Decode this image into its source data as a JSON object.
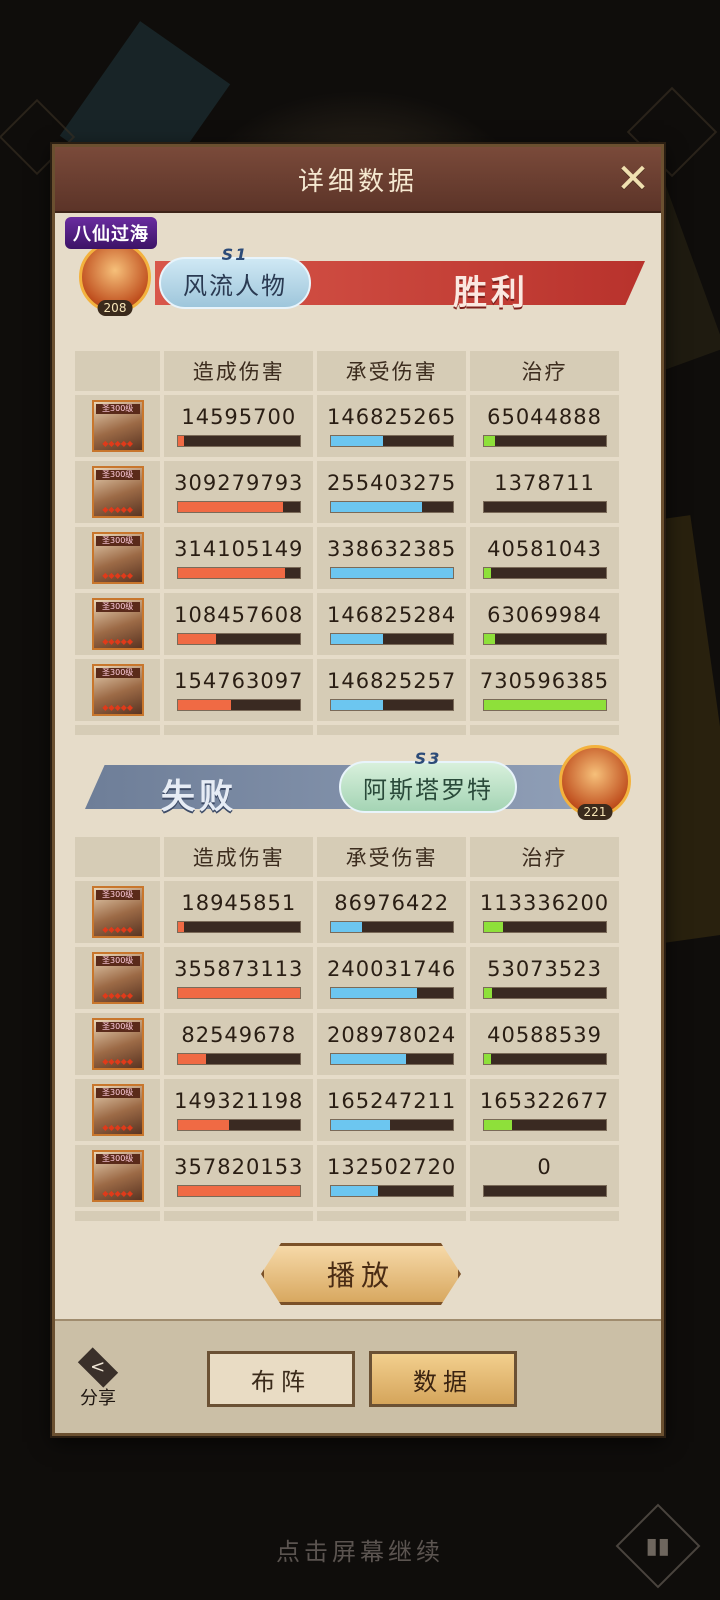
{
  "panel": {
    "title": "详细数据",
    "close_icon": "close-icon"
  },
  "team_top": {
    "badge": "八仙过海",
    "season": "S1",
    "name": "风流人物",
    "level": "208",
    "result": "胜利",
    "result_color": "#c23a2e"
  },
  "team_bottom": {
    "season": "S3",
    "name": "阿斯塔罗特",
    "level": "221",
    "result": "失败",
    "result_color": "#6e7e98"
  },
  "columns": {
    "damage": "造成伤害",
    "taken": "承受伤害",
    "heal": "治疗"
  },
  "hero_level_label": "圣300级",
  "top_rows": [
    {
      "damage": "14595700",
      "damage_frac": 0.05,
      "taken": "146825265",
      "taken_frac": 0.43,
      "heal": "65044888",
      "heal_frac": 0.09
    },
    {
      "damage": "309279793",
      "damage_frac": 0.86,
      "taken": "255403275",
      "taken_frac": 0.75,
      "heal": "1378711",
      "heal_frac": 0.0
    },
    {
      "damage": "314105149",
      "damage_frac": 0.88,
      "taken": "338632385",
      "taken_frac": 1.0,
      "heal": "40581043",
      "heal_frac": 0.06
    },
    {
      "damage": "108457608",
      "damage_frac": 0.31,
      "taken": "146825284",
      "taken_frac": 0.43,
      "heal": "63069984",
      "heal_frac": 0.09
    },
    {
      "damage": "154763097",
      "damage_frac": 0.44,
      "taken": "146825257",
      "taken_frac": 0.43,
      "heal": "730596385",
      "heal_frac": 1.0
    }
  ],
  "bottom_rows": [
    {
      "damage": "18945851",
      "damage_frac": 0.05,
      "taken": "86976422",
      "taken_frac": 0.26,
      "heal": "113336200",
      "heal_frac": 0.16
    },
    {
      "damage": "355873113",
      "damage_frac": 1.0,
      "taken": "240031746",
      "taken_frac": 0.71,
      "heal": "53073523",
      "heal_frac": 0.07
    },
    {
      "damage": "82549678",
      "damage_frac": 0.23,
      "taken": "208978024",
      "taken_frac": 0.62,
      "heal": "40588539",
      "heal_frac": 0.06
    },
    {
      "damage": "149321198",
      "damage_frac": 0.42,
      "taken": "165247211",
      "taken_frac": 0.49,
      "heal": "165322677",
      "heal_frac": 0.23
    },
    {
      "damage": "357820153",
      "damage_frac": 1.0,
      "taken": "132502720",
      "taken_frac": 0.39,
      "heal": "0",
      "heal_frac": 0.0
    }
  ],
  "play_button": "播放",
  "footer": {
    "share_label": "分享",
    "share_icon": "share-icon",
    "tab_formation": "布阵",
    "tab_data": "数据"
  },
  "continue_text": "点击屏幕继续",
  "stats_icon": "bar-chart-icon"
}
